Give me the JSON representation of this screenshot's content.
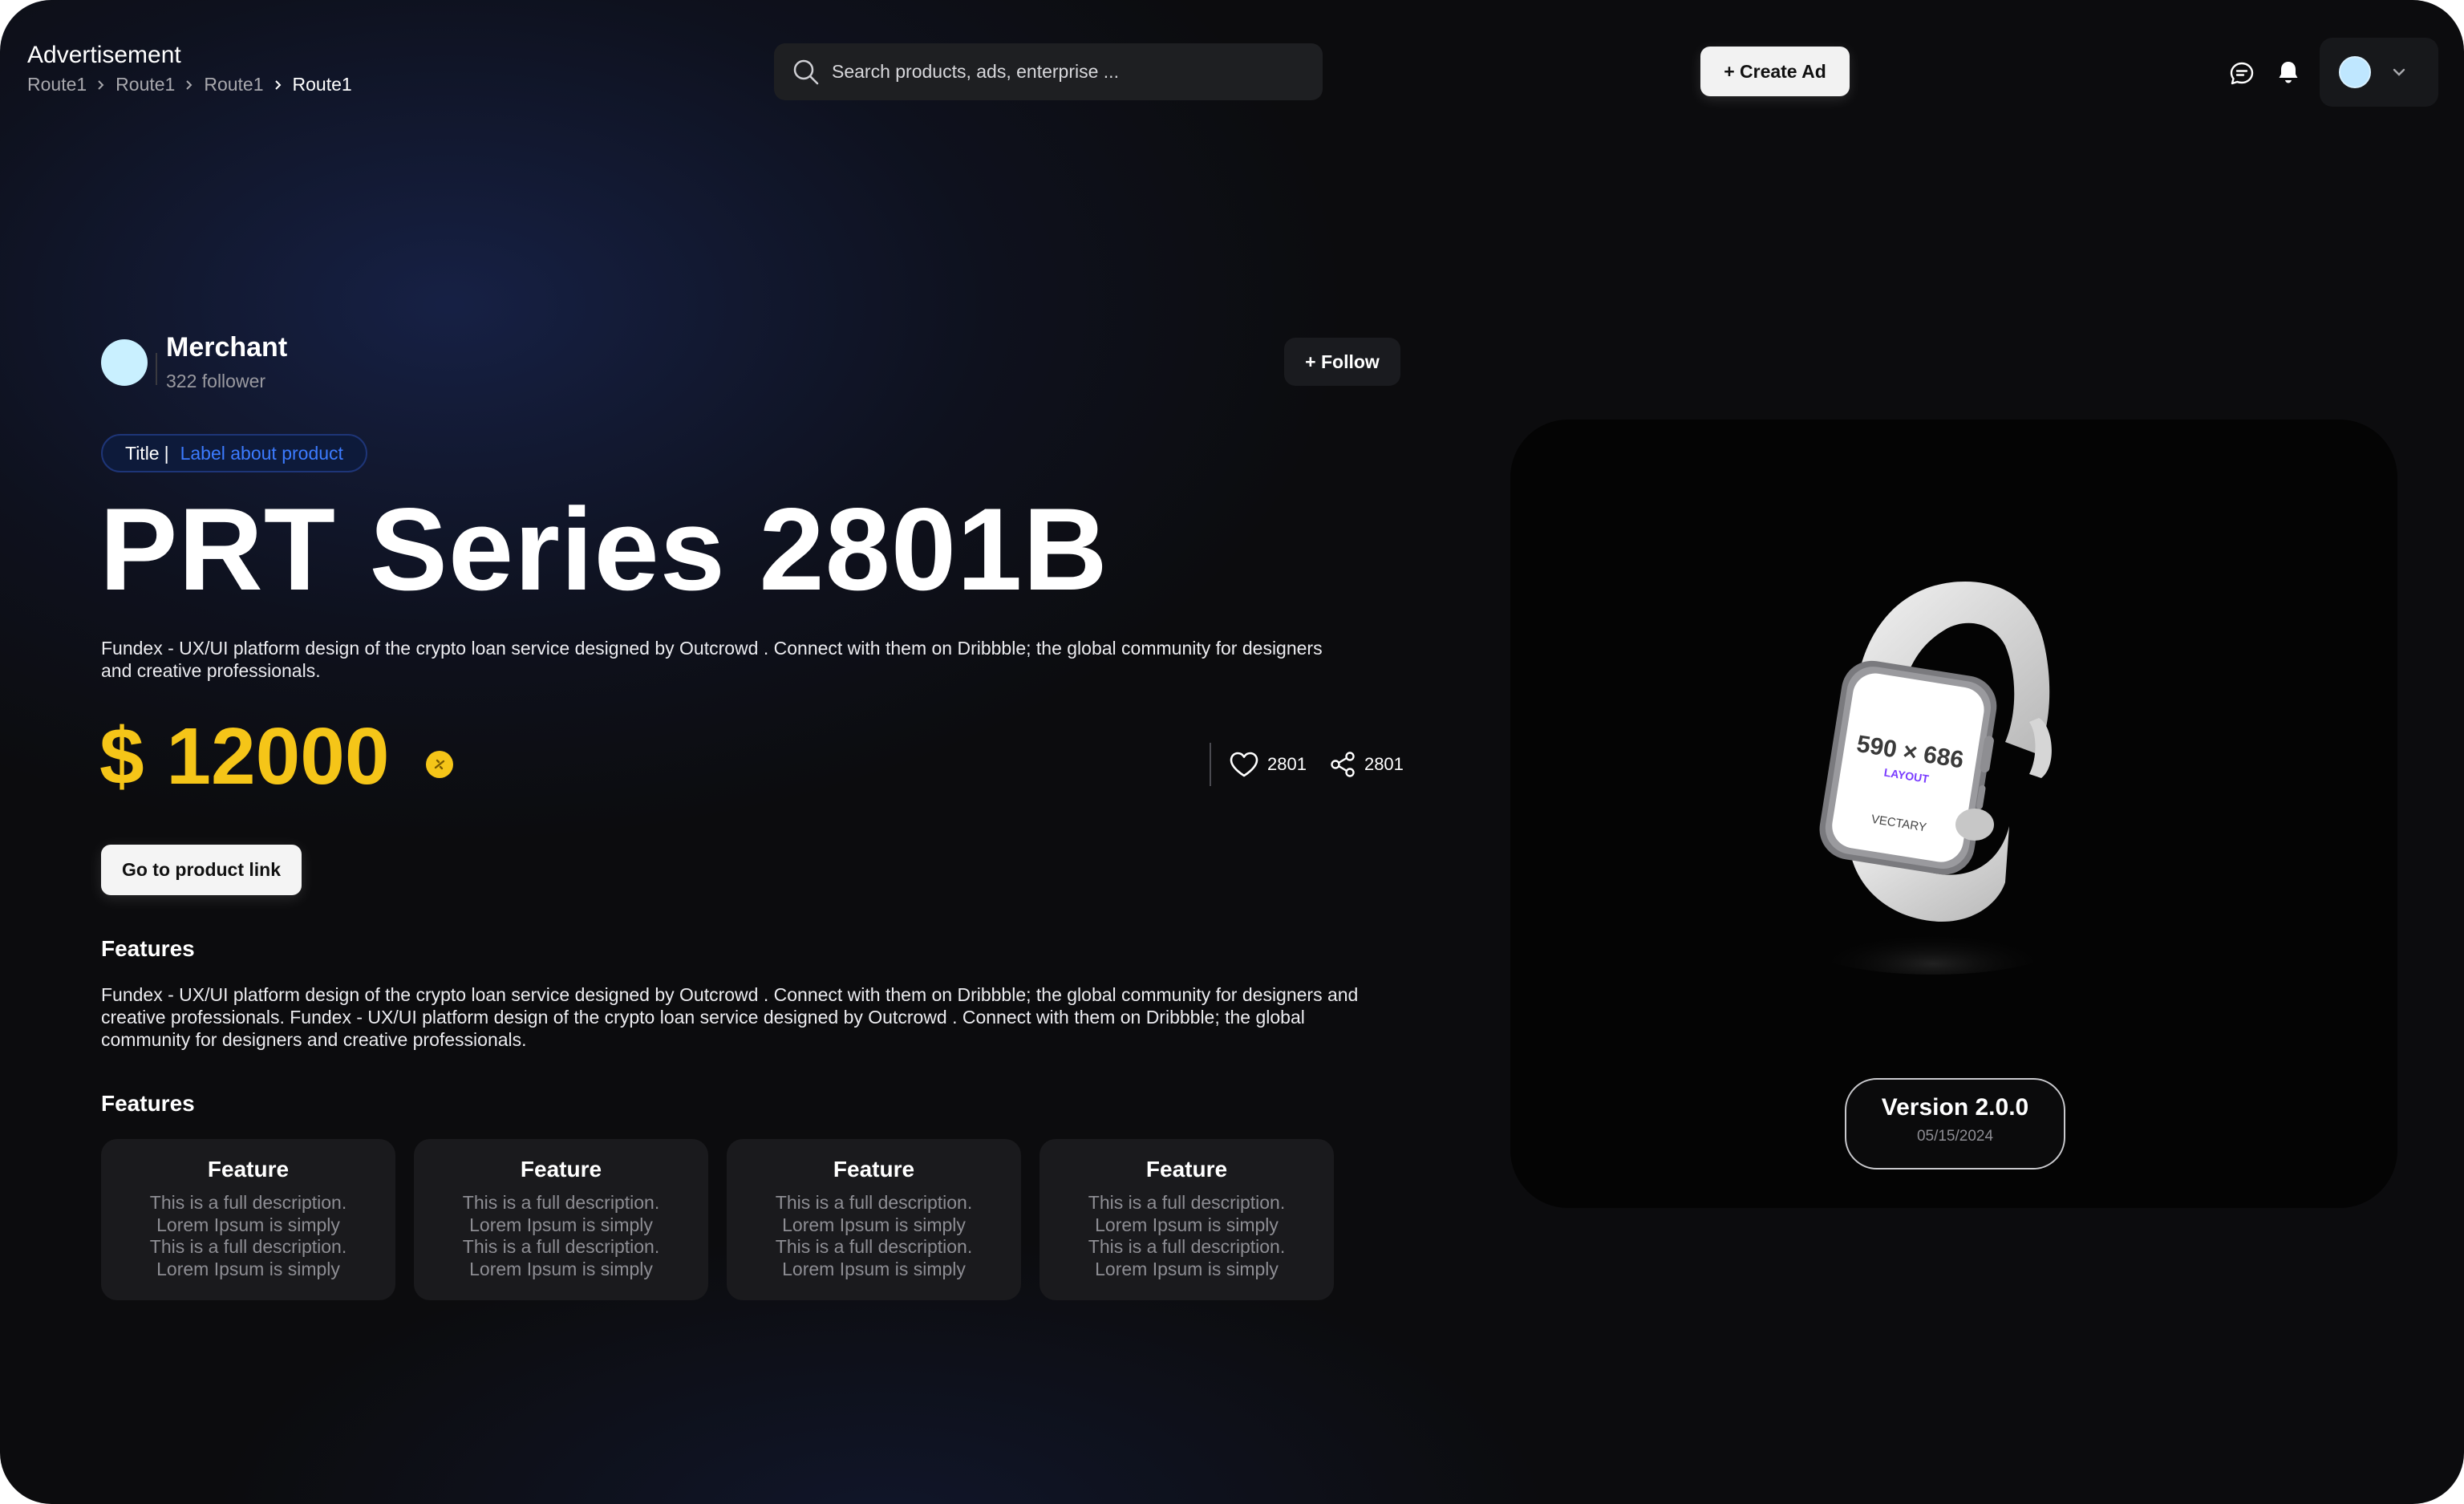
{
  "header": {
    "app_title": "Advertisement",
    "breadcrumb": [
      "Route1",
      "Route1",
      "Route1",
      "Route1"
    ],
    "search_placeholder": "Search products, ads, enterprise ...",
    "create_button": "+ Create Ad"
  },
  "merchant": {
    "name": "Merchant",
    "followers": "322 follower",
    "follow_button": "+ Follow"
  },
  "tag": {
    "title": "Title",
    "separator": "|",
    "label": "Label about product"
  },
  "product": {
    "title": "PRT Series 2801B",
    "description": "Fundex - UX/UI platform design of the crypto loan service designed by Outcrowd . Connect with them on Dribbble; the global community for designers and creative professionals.",
    "price": "$ 12000",
    "likes": "2801",
    "shares": "2801",
    "link_button": "Go to product link"
  },
  "features_section": {
    "heading": "Features",
    "text": "Fundex - UX/UI platform design of the crypto loan service designed by Outcrowd . Connect with them on Dribbble; the global community for designers and creative professionals. Fundex - UX/UI platform design of the crypto loan service designed by Outcrowd . Connect with them on Dribbble; the global community for designers and creative professionals."
  },
  "feature_cards": {
    "heading": "Features",
    "cards": [
      {
        "title": "Feature",
        "lines": [
          "This is a full description.",
          "Lorem Ipsum is simply",
          "This is a full description.",
          "Lorem Ipsum is simply"
        ]
      },
      {
        "title": "Feature",
        "lines": [
          "This is a full description.",
          "Lorem Ipsum is simply",
          "This is a full description.",
          "Lorem Ipsum is simply"
        ]
      },
      {
        "title": "Feature",
        "lines": [
          "This is a full description.",
          "Lorem Ipsum is simply",
          "This is a full description.",
          "Lorem Ipsum is simply"
        ]
      },
      {
        "title": "Feature",
        "lines": [
          "This is a full description.",
          "Lorem Ipsum is simply",
          "This is a full description.",
          "Lorem Ipsum is simply"
        ]
      }
    ]
  },
  "preview": {
    "screen_size": "590 × 686",
    "screen_layout": "LAYOUT",
    "screen_brand": "VECTARY",
    "version": "Version 2.0.0",
    "date": "05/15/2024"
  },
  "colors": {
    "background": "#0c0c0e",
    "price": "#f5c518",
    "tag_label": "#3c7bff",
    "panel": "#040404"
  },
  "icons": {
    "search": "search-icon",
    "chat": "chat-icon",
    "bell": "bell-icon",
    "chevron": "chevron-down-icon",
    "heart": "heart-icon",
    "share": "share-icon",
    "coin": "coin-icon"
  }
}
